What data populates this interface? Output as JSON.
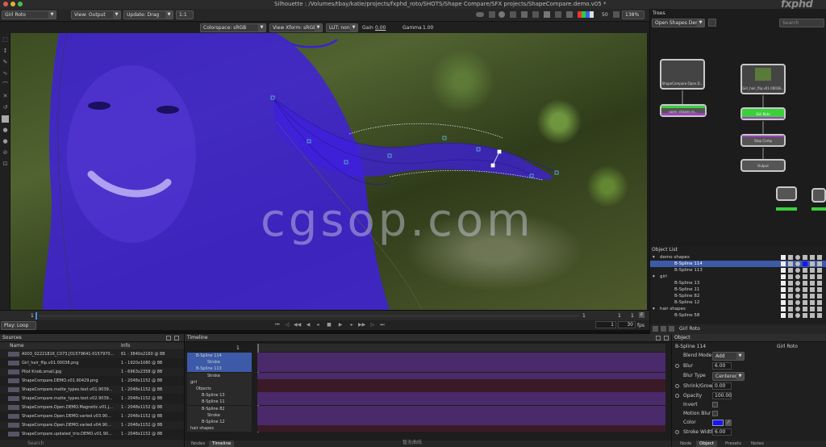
{
  "titlebar": {
    "title": "Silhouette : /Volumes/tbay/katie/projects/fxphd_roto/SHOTS/Shape Compare/SFX projects/ShapeCompare.demo.v05 *",
    "brand": "fxphd"
  },
  "toolbar": {
    "node_select": "Girl Roto",
    "view_select": "View: Output",
    "update_select": "Update: Drag",
    "zoom_ratio": "1:1",
    "frame_value": "50",
    "zoom_percent": "138%"
  },
  "subtool": {
    "colorspace": "Colorspace: sRGB",
    "view_xform": "View Xform: sRGB",
    "lut": "LUT: none",
    "gain_label": "Gain",
    "gain_value": "0.00",
    "gamma_label": "Gamma",
    "gamma_value": "1.00"
  },
  "viewer": {
    "watermark": "cgsop.com",
    "bottom_caption": "暂无曲线"
  },
  "scrub": {
    "start": "1",
    "end1": "1",
    "end2": "1",
    "end3": "1",
    "f_label": "F"
  },
  "transport": {
    "play_mode": "Play: Loop",
    "current": "1",
    "fps_value": "30",
    "fps_label": "fps"
  },
  "trees": {
    "title": "Trees",
    "tree_select": "Open Shapes Demo",
    "search_placeholder": "Search",
    "nodes": {
      "shape_compare": "ShapeCompare.Open.D...",
      "open_shapes": "open_shapes ro...",
      "girl_hair": "Girl_hair_flip.v01.00038...",
      "girl_roto": "Girl Roto",
      "stop_comp": "Stop Comp",
      "output": "Output"
    }
  },
  "object_list": {
    "title": "Object List",
    "footer_label": "Girl Roto",
    "rows": [
      {
        "label": "demo shapes",
        "group": true
      },
      {
        "label": "B-Spline 114",
        "group": false,
        "selected": true
      },
      {
        "label": "B-Spline 113",
        "group": false
      },
      {
        "label": "girl",
        "group": true
      },
      {
        "label": "B-Spline 13",
        "group": false
      },
      {
        "label": "B-Spline 11",
        "group": false
      },
      {
        "label": "B-Spline 82",
        "group": false
      },
      {
        "label": "B-Spline 12",
        "group": false
      },
      {
        "label": "hair shapes",
        "group": true
      },
      {
        "label": "B-Spline 58",
        "group": false
      }
    ]
  },
  "sources": {
    "title": "Sources",
    "col_name": "Name",
    "col_info": "Info",
    "search_placeholder": "Search",
    "rows": [
      {
        "name": "A003_02221816_C073.[01579641-0157970...",
        "info": "61 - 3840x2160 @ 8B"
      },
      {
        "name": "Girl_hair_flip.v01.00038.png",
        "info": "1 - 1920x1080 @ 8B"
      },
      {
        "name": "Pilot Knob.small.jpg",
        "info": "1 - 6963x2358 @ 8B"
      },
      {
        "name": "ShapeCompare.DEMO.v01.90429.png",
        "info": "1 - 2048x1152 @ 8B"
      },
      {
        "name": "ShapeCompare.matte_types.text.v01.9039...",
        "info": "1 - 2048x1152 @ 8B"
      },
      {
        "name": "ShapeCompare.matte_types.text.v02.9039...",
        "info": "1 - 2048x1152 @ 8B"
      },
      {
        "name": "ShapeCompare.Open.DEMO.Magnetic.v01.j...",
        "info": "1 - 2048x1152 @ 8B"
      },
      {
        "name": "ShapeCompare.Open.DEMO.varied.v03.90...",
        "info": "1 - 2048x1152 @ 8B"
      },
      {
        "name": "ShapeCompare.Open.DEMO.varied.v04.90...",
        "info": "1 - 2048x1152 @ 8B"
      },
      {
        "name": "ShapeCompare.updated_trio.DEMO.v01.90...",
        "info": "1 - 2048x1152 @ 8B"
      }
    ]
  },
  "timeline": {
    "title": "Timeline",
    "frame": "1",
    "rows": [
      {
        "label": "B-Spline 114",
        "indent": 1,
        "kind": "shape",
        "selected": true
      },
      {
        "label": "Stroke",
        "indent": 3,
        "kind": "stroke",
        "selected": true
      },
      {
        "label": "B-Spline 113",
        "indent": 1,
        "kind": "shape",
        "selected": true
      },
      {
        "label": "Stroke",
        "indent": 3,
        "kind": "stroke",
        "selected": false
      },
      {
        "label": "girl",
        "indent": 0,
        "kind": "group",
        "selected": false
      },
      {
        "label": "Objects",
        "indent": 1,
        "kind": "group",
        "selected": false
      },
      {
        "label": "B-Spline 13",
        "indent": 2,
        "kind": "shape",
        "selected": false
      },
      {
        "label": "B-Spline 11",
        "indent": 2,
        "kind": "shape",
        "selected": false
      },
      {
        "label": "B-Spline 82",
        "indent": 2,
        "kind": "shape",
        "selected": false
      },
      {
        "label": "Stroke",
        "indent": 3,
        "kind": "stroke",
        "selected": false
      },
      {
        "label": "B-Spline 12",
        "indent": 2,
        "kind": "shape",
        "selected": false
      },
      {
        "label": "hair shapes",
        "indent": 0,
        "kind": "group",
        "selected": false
      }
    ],
    "tabs": [
      "Nodes",
      "Timeline"
    ]
  },
  "object_panel": {
    "title": "Object",
    "object_name": "B-Spline 114",
    "node_name": "Girl Roto",
    "blend_mode_label": "Blend Mode",
    "blend_mode_value": "Add",
    "blur_label": "Blur",
    "blur_value": "6.00",
    "blur_type_label": "Blur Type",
    "blur_type_value": "Centered",
    "shrink_grow_label": "Shrink/Grow",
    "shrink_grow_value": "0.00",
    "opacity_label": "Opacity",
    "opacity_value": "100.00",
    "invert_label": "Invert",
    "motion_blur_label": "Motion Blur",
    "color_label": "Color",
    "stroke_width_label": "Stroke Width",
    "stroke_width_value": "6.00",
    "color_hex": "#1414ff",
    "tabs": [
      "Node",
      "Object",
      "Presets",
      "Notes"
    ]
  },
  "colors": {
    "matte": "#3f1fe0",
    "selection": "#3c5aa8",
    "track_shape": "#4a2a6a",
    "track_group": "#3a1a26"
  }
}
